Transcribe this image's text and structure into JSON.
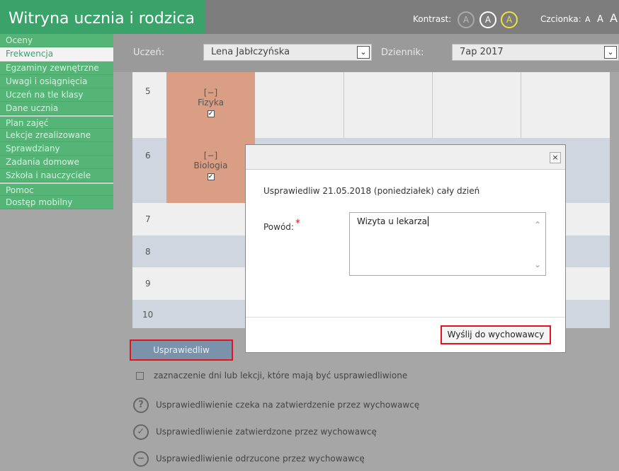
{
  "header": {
    "app_title": "Witryna ucznia i rodzica",
    "kontrast_label": "Kontrast:",
    "kontrast_buttons": [
      "A",
      "A",
      "A"
    ],
    "czcionka_label": "Czcionka:",
    "font_sizes": [
      "A",
      "A",
      "A"
    ]
  },
  "sidebar": {
    "items": [
      {
        "label": "Oceny"
      },
      {
        "label": "Frekwencja"
      },
      {
        "label": "Egzaminy zewnętrzne"
      },
      {
        "label": "Uwagi i osiągnięcia"
      },
      {
        "label": "Uczeń na tle klasy"
      },
      {
        "label": "Dane ucznia"
      },
      {
        "label": "Plan zajęć"
      },
      {
        "label": "Lekcje zrealizowane"
      },
      {
        "label": "Sprawdziany"
      },
      {
        "label": "Zadania domowe"
      },
      {
        "label": "Szkoła i nauczyciele"
      },
      {
        "label": "Pomoc"
      },
      {
        "label": "Dostęp mobilny"
      }
    ]
  },
  "filters": {
    "student_label": "Uczeń:",
    "student_value": "Lena Jabłczyńska",
    "journal_label": "Dziennik:",
    "journal_value": "7ap 2017"
  },
  "timetable": {
    "lesson_numbers": [
      "5",
      "6",
      "7",
      "8",
      "9",
      "10"
    ],
    "lessons": [
      {
        "bracket": "[−]",
        "subject": "Fizyka",
        "check": "✓"
      },
      {
        "bracket": "[−]",
        "subject": "Biologia",
        "check": "✓"
      }
    ]
  },
  "actions": {
    "excuse_button": "Usprawiedliw"
  },
  "legend": {
    "select_hint": "zaznaczenie dni lub lekcji, które mają być usprawiedliwione",
    "pending": "Usprawiedliwienie czeka na zatwierdzenie przez wychowawcę",
    "approved": "Usprawiedliwienie zatwierdzone przez wychowawcę",
    "rejected": "Usprawiedliwienie odrzucone przez wychowawcę",
    "pending_icon": "?",
    "approved_icon": "✓",
    "rejected_icon": "−"
  },
  "modal": {
    "close": "×",
    "message": "Usprawiedliw 21.05.2018 (poniedziałek) cały dzień",
    "reason_label": "Powód:",
    "required_mark": "*",
    "reason_value": "Wizyta u lekarza",
    "scroll_up": "⌃",
    "scroll_down": "⌄",
    "send_button": "Wyślij do wychowawcy"
  },
  "colors": {
    "brand_green": "#3aa36a",
    "lesson_fill": "#d99e84",
    "highlight_red": "#e3141b"
  }
}
